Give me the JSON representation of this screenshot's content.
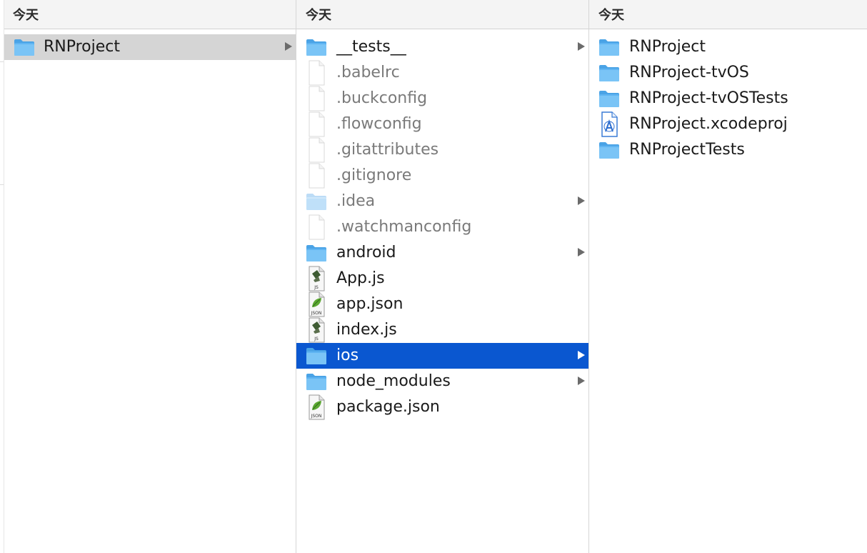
{
  "columns": [
    {
      "header": "今天",
      "items": [
        {
          "label": "RNProject",
          "icon": "folder-icon",
          "arrow": true,
          "state": "selected-inactive"
        }
      ]
    },
    {
      "header": "今天",
      "items": [
        {
          "label": "__tests__",
          "icon": "folder-icon",
          "arrow": true
        },
        {
          "label": ".babelrc",
          "icon": "file-icon",
          "dim": true
        },
        {
          "label": ".buckconfig",
          "icon": "file-icon",
          "dim": true
        },
        {
          "label": ".flowconfig",
          "icon": "file-icon",
          "dim": true
        },
        {
          "label": ".gitattributes",
          "icon": "file-icon",
          "dim": true
        },
        {
          "label": ".gitignore",
          "icon": "file-icon",
          "dim": true
        },
        {
          "label": ".idea",
          "icon": "folder-icon",
          "dim": true,
          "arrow": true
        },
        {
          "label": ".watchmanconfig",
          "icon": "file-icon",
          "dim": true
        },
        {
          "label": "android",
          "icon": "folder-icon",
          "arrow": true
        },
        {
          "label": "App.js",
          "icon": "js-file-icon"
        },
        {
          "label": "app.json",
          "icon": "json-file-icon"
        },
        {
          "label": "index.js",
          "icon": "js-file-icon"
        },
        {
          "label": "ios",
          "icon": "folder-icon",
          "arrow": true,
          "state": "selected"
        },
        {
          "label": "node_modules",
          "icon": "folder-icon",
          "arrow": true
        },
        {
          "label": "package.json",
          "icon": "json-file-icon"
        }
      ]
    },
    {
      "header": "今天",
      "items": [
        {
          "label": "RNProject",
          "icon": "folder-icon"
        },
        {
          "label": "RNProject-tvOS",
          "icon": "folder-icon"
        },
        {
          "label": "RNProject-tvOSTests",
          "icon": "folder-icon"
        },
        {
          "label": "RNProject.xcodeproj",
          "icon": "xcodeproj-icon"
        },
        {
          "label": "RNProjectTests",
          "icon": "folder-icon"
        }
      ]
    }
  ],
  "colors": {
    "selection_active": "#0a57d0",
    "selection_inactive": "#d5d5d5",
    "folder": "#5fb4f2"
  }
}
